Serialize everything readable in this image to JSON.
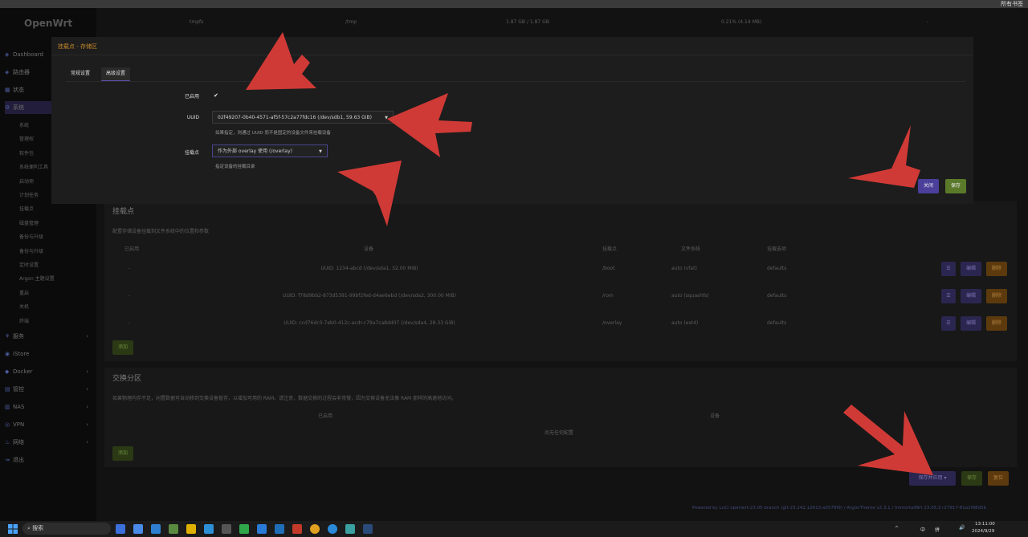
{
  "window": {
    "corner_label": "所有书签"
  },
  "sidebar": {
    "logo": "OpenWrt",
    "items": [
      {
        "label": "Dashboard",
        "icon": "dashboard-icon",
        "glyph": "◈"
      },
      {
        "label": "路由器",
        "icon": "router-icon",
        "glyph": "◈"
      },
      {
        "label": "状态",
        "icon": "status-icon",
        "glyph": "▦"
      },
      {
        "label": "系统",
        "icon": "gear-icon",
        "glyph": "⚙"
      }
    ],
    "sub_items": [
      "系统",
      "管理权",
      "软件包",
      "系统便利工具",
      "启动项",
      "计划任务",
      "挂载点",
      "磁盘管理",
      "备份与升级",
      "备份与升级",
      "定时设置",
      "Argon 主题设置",
      "重启",
      "关机",
      "终端"
    ],
    "bottom_items": [
      {
        "label": "服务",
        "icon": "services-icon",
        "glyph": "⚘"
      },
      {
        "label": "iStore",
        "icon": "store-icon",
        "glyph": "◉"
      },
      {
        "label": "Docker",
        "icon": "docker-icon",
        "glyph": "◆"
      },
      {
        "label": "管控",
        "icon": "control-icon",
        "glyph": "▤"
      },
      {
        "label": "NAS",
        "icon": "nas-icon",
        "glyph": "▥"
      },
      {
        "label": "VPN",
        "icon": "vpn-icon",
        "glyph": "◎"
      },
      {
        "label": "网络",
        "icon": "network-icon",
        "glyph": "♨"
      },
      {
        "label": "退出",
        "icon": "logout-icon",
        "glyph": "⇥"
      }
    ]
  },
  "top_row": {
    "c1": "tmpfs",
    "c2": "/tmp",
    "c3": "1.87 GB / 1.87 GB",
    "c4": "0.21% (4.14 MB)",
    "c5": "-"
  },
  "mounts": {
    "title": "挂载点",
    "desc": "配置存储设备挂载到文件系统中的位置和参数",
    "headers": [
      "已启用",
      "设备",
      "挂载点",
      "文件系统",
      "挂载选项"
    ],
    "rows": [
      {
        "enabled": "-",
        "device": "UUID: 1234-abcd (/dev/sda1, 32.00 MiB)",
        "mount": "/boot",
        "fs": "auto (vfat)",
        "opts": "defaults"
      },
      {
        "enabled": "-",
        "device": "UUID: f78d9bb2-873d5391-99bf2fed-d4ae6ebd (/dev/sda2, 300.00 MiB)",
        "mount": "/rom",
        "fs": "auto (squashfs)",
        "opts": "defaults"
      },
      {
        "enabled": "-",
        "device": "UUID: ccd76dc0-7eb0-412c-acdr-c79a7ca8dd07 (/dev/sda4, 28.33 GiB)",
        "mount": "/overlay",
        "fs": "auto (ext4)",
        "opts": "defaults"
      }
    ],
    "row_buttons": {
      "more": "☰",
      "edit": "编辑",
      "delete": "删除"
    },
    "add": "添加"
  },
  "swap": {
    "title": "交换分区",
    "desc": "如果物理内存不足，闲置数据可自动移到交换设备暂存，以增加可用的 RAM。请注意，数据交换的过程会非常慢，因为交换设备无法像 RAM 那样的高速地访问。",
    "headers": [
      "已启用",
      "设备"
    ],
    "empty": "尚无任何配置",
    "add": "添加"
  },
  "footer": {
    "save_apply": "保存并应用",
    "save": "保存",
    "reset": "复位",
    "powered": "Powered by LuCI openwrt-23.05 branch (git-23.242.12613-a0578f9) / ArgonTheme v2.3.1 / ImmortalWrt 23.05.3 r27917-81a1f98d5b"
  },
  "modal": {
    "title": "挂载点 - 存储区",
    "tabs": [
      "常规设置",
      "高级设置"
    ],
    "enabled_label": "已启用",
    "enabled_check": "✔",
    "uuid_label": "UUID",
    "uuid_value": "02f49207-0b40-4571-af5f-57c2a77fdc16 (/dev/sdb1, 59.63 GiB)",
    "uuid_hint": "如果指定，则通过 UUID 而不是固定的设备文件来挂载设备",
    "mount_label": "挂载点",
    "mount_value": "作为外部 overlay 使用 (/overlay)",
    "mount_hint": "指定设备的挂载目录",
    "close": "关闭",
    "save": "保存"
  },
  "taskbar": {
    "search": "搜索",
    "tray": {
      "lang1": "中",
      "lang2": "拼",
      "time": "13:11:00",
      "date": "2024/9/29",
      "caret": "^",
      "volume": "🔊"
    }
  }
}
